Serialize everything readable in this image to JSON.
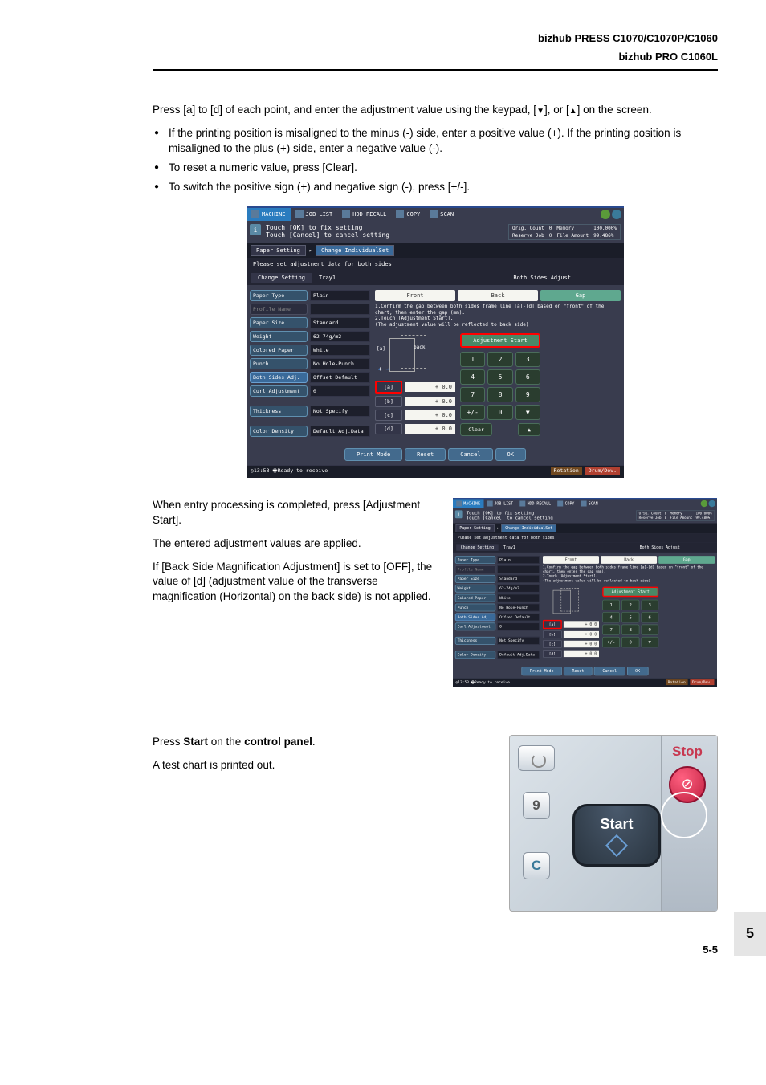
{
  "header": {
    "line1": "bizhub PRESS C1070/C1070P/C1060",
    "line2": "bizhub PRO C1060L"
  },
  "para1_prefix": "Press [a] to [d] of each point, and enter the adjustment value using the keypad, [",
  "para1_mid": "], or [",
  "para1_suffix": "] on the screen.",
  "bullets": [
    "If the printing position is misaligned to the minus (-) side, enter a positive value (+). If the printing position is misaligned to the plus (+) side, enter a negative value (-).",
    "To reset a numeric value, press [Clear].",
    "To switch the positive sign (+) and negative sign (-), press [+/-]."
  ],
  "para2": "When entry processing is completed, press [Adjustment Start].",
  "para3": "The entered adjustment values are applied.",
  "para4": "If [Back Side Magnification Adjustment] is set to [OFF], the value of [d] (adjustment value of the transverse magnification (Horizontal) on the back side) is not applied.",
  "para5_a": "Press ",
  "para5_b": "Start",
  "para5_c": " on the ",
  "para5_d": "control panel",
  "para5_e": ".",
  "para6": "A test chart is printed out.",
  "sidetab": "5",
  "pagenum": "5-5",
  "screen": {
    "tabs": {
      "machine": "MACHINE",
      "joblist": "JOB LIST",
      "hdd": "HDD RECALL",
      "copy": "COPY",
      "scan": "SCAN"
    },
    "info": {
      "l1": "Touch [OK] to fix setting",
      "l2": "Touch [Cancel] to cancel setting"
    },
    "status": {
      "orig": "Orig. Count",
      "origv": "0",
      "mem": "Memory",
      "memv": "100.000%",
      "res": "Reserve Job",
      "resv": "0",
      "file": "File Amount",
      "filev": "99.486%"
    },
    "crumb": {
      "a": "Paper Setting",
      "b": "Change IndividualSet"
    },
    "instr": "Please set adjustment data for both sides",
    "titlebar": {
      "a": "Change Setting",
      "b": "Tray1",
      "r": "Both Sides Adjust"
    },
    "left": {
      "paper_type": {
        "l": "Paper Type",
        "v": "Plain"
      },
      "profile": {
        "l": "Profile Name",
        "v": ""
      },
      "paper_size": {
        "l": "Paper Size",
        "v": "Standard"
      },
      "weight": {
        "l": "Weight",
        "v": "62-74g/m2"
      },
      "colored": {
        "l": "Colored Paper",
        "v": "White"
      },
      "punch": {
        "l": "Punch",
        "v": "No Hole-Punch"
      },
      "both": {
        "l": "Both Sides Adj.",
        "v": "Offset Default"
      },
      "curl": {
        "l": "Curl Adjustment",
        "v": "0"
      },
      "thick": {
        "l": "Thickness",
        "v": "Not Specify"
      },
      "density": {
        "l": "Color Density",
        "v": "Default Adj.Data"
      }
    },
    "subtabs": {
      "front": "Front",
      "back": "Back",
      "gap": "Gap"
    },
    "confirm": "1.Confirm the gap between both sides frame line [a]-[d] based on \"front\" of the chart, then enter the gap (mm).\n2.Touch [Adjustment Start].\n  (The adjustment value will be reflected to back side)",
    "diag": {
      "a": "[a]",
      "back": "back"
    },
    "vals": {
      "a": "[a]",
      "b": "[b]",
      "c": "[c]",
      "d": "[d]",
      "va": "+ 0.0",
      "vb": "+ 0.0",
      "vc": "+ 0.0",
      "vd": "+ 0.0"
    },
    "adjstart": "Adjustment Start",
    "keys": {
      "k1": "1",
      "k2": "2",
      "k3": "3",
      "k4": "4",
      "k5": "5",
      "k6": "6",
      "k7": "7",
      "k8": "8",
      "k9": "9",
      "pm": "+/-",
      "k0": "0",
      "down": "▼",
      "up": "▲",
      "clear": "Clear"
    },
    "bottom": {
      "print": "Print Mode",
      "reset": "Reset",
      "cancel": "Cancel",
      "ok": "OK"
    },
    "footer": {
      "time": "13:53",
      "ready": "Ready to receive",
      "rot": "Rotation",
      "drum": "Drum/Dev."
    }
  },
  "ctrl": {
    "start": "Start",
    "stop": "Stop",
    "nine": "9",
    "c": "C",
    "stopicon": "⊘"
  }
}
